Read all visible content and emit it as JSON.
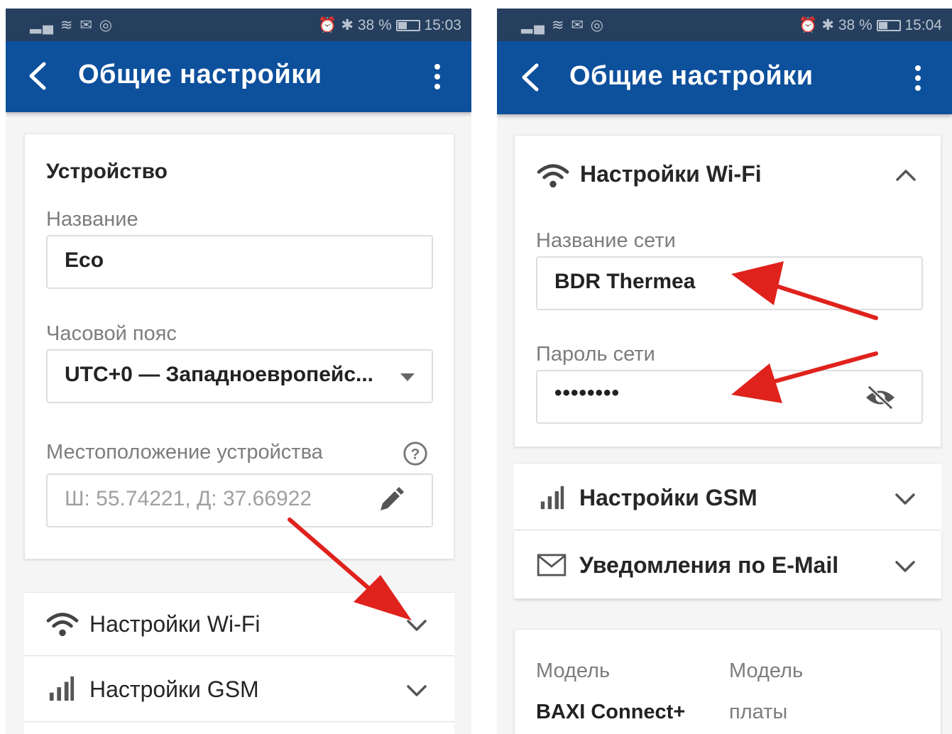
{
  "left": {
    "status": {
      "indicators": "▂▄ ≋ ✉ ◎",
      "alarm": "⏰",
      "bluetooth": "✱",
      "battery_percent": "38 %",
      "time": "15:03"
    },
    "appbar": {
      "title": "Общие настройки",
      "back_icon": "chevron-left-icon",
      "more_icon": "more-vert-icon"
    },
    "device_card": {
      "heading": "Устройство",
      "name_label": "Название",
      "name_value": "Eco",
      "timezone_label": "Часовой пояс",
      "timezone_value": "UTC+0 — Западноевропейс...",
      "location_label": "Местоположение устройства",
      "location_value": "Ш: 55.74221, Д: 37.66922"
    },
    "rows": [
      {
        "label": "Настройки Wi-Fi",
        "icon": "wifi-icon",
        "expanded": false
      },
      {
        "label": "Настройки GSM",
        "icon": "signal-icon",
        "expanded": false
      }
    ]
  },
  "right": {
    "status": {
      "indicators": "▂▄ ≋ ✉ ◎",
      "alarm": "⏰",
      "bluetooth": "✱",
      "battery_percent": "38 %",
      "time": "15:04"
    },
    "appbar": {
      "title": "Общие настройки",
      "back_icon": "chevron-left-icon",
      "more_icon": "more-vert-icon"
    },
    "wifi_card": {
      "heading": "Настройки Wi-Fi",
      "expanded": true,
      "ssid_label": "Название сети",
      "ssid_value": "BDR Thermea",
      "password_label": "Пароль сети",
      "password_value": "••••••••"
    },
    "rows": [
      {
        "label": "Настройки GSM",
        "icon": "signal-icon",
        "expanded": false
      },
      {
        "label": "Уведомления по E-Mail",
        "icon": "mail-icon",
        "expanded": false
      }
    ],
    "info_card": {
      "col1_label": "Модель",
      "col1_value": "BAXI Connect+",
      "col2_label": "Модель",
      "col2_value": "платы"
    }
  },
  "colors": {
    "appbar": "#0d509c",
    "statusbar": "#263f5e",
    "annotation_arrow": "#e0221d"
  }
}
